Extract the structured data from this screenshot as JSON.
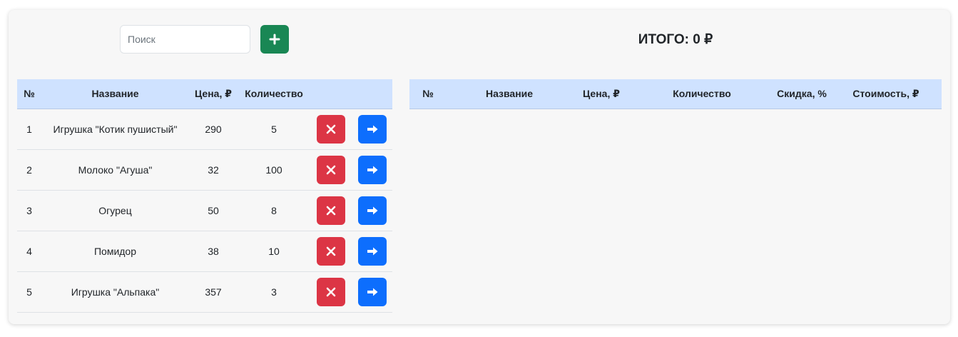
{
  "search": {
    "placeholder": "Поиск",
    "value": ""
  },
  "add_button": {
    "icon": "plus-icon",
    "color": "#198754"
  },
  "total": {
    "label": "ИТОГО: 0 ₽"
  },
  "products_table": {
    "headers": [
      "№",
      "Название",
      "Цена, ₽",
      "Количество"
    ],
    "rows": [
      {
        "num": "1",
        "name": "Игрушка \"Котик пушистый\"",
        "price": "290",
        "qty": "5"
      },
      {
        "num": "2",
        "name": "Молоко \"Агуша\"",
        "price": "32",
        "qty": "100"
      },
      {
        "num": "3",
        "name": "Огурец",
        "price": "50",
        "qty": "8"
      },
      {
        "num": "4",
        "name": "Помидор",
        "price": "38",
        "qty": "10"
      },
      {
        "num": "5",
        "name": "Игрушка \"Альпака\"",
        "price": "357",
        "qty": "3"
      }
    ],
    "delete_icon": "x-icon",
    "move_icon": "arrow-right-icon",
    "delete_color": "#dc3545",
    "move_color": "#0d6efd"
  },
  "cart_table": {
    "headers": [
      "№",
      "Название",
      "Цена, ₽",
      "Количество",
      "Скидка, %",
      "Стоимость, ₽"
    ],
    "rows": []
  },
  "colors": {
    "header_bg": "#cfe2ff",
    "card_bg": "#f7f7f7"
  }
}
